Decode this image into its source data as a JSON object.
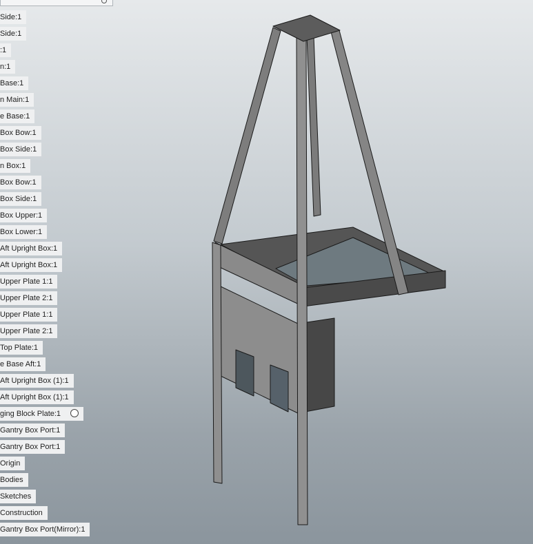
{
  "browser": {
    "items": [
      {
        "label": "Side:1"
      },
      {
        "label": "Side:1"
      },
      {
        "label": ":1"
      },
      {
        "label": "n:1"
      },
      {
        "label": "Base:1"
      },
      {
        "label": "n Main:1"
      },
      {
        "label": "e Base:1"
      },
      {
        "label": "Box Bow:1"
      },
      {
        "label": "Box Side:1"
      },
      {
        "label": "n Box:1"
      },
      {
        "label": "Box Bow:1"
      },
      {
        "label": "Box Side:1"
      },
      {
        "label": "Box Upper:1"
      },
      {
        "label": "Box Lower:1"
      },
      {
        "label": "Aft Upright Box:1"
      },
      {
        "label": "Aft Upright Box:1"
      },
      {
        "label": "Upper Plate 1:1"
      },
      {
        "label": "Upper Plate 2:1"
      },
      {
        "label": "Upper Plate 1:1"
      },
      {
        "label": "Upper Plate 2:1"
      },
      {
        "label": "Top Plate:1"
      },
      {
        "label": "e Base Aft:1"
      },
      {
        "label": "Aft Upright Box (1):1"
      },
      {
        "label": "Aft Upright Box (1):1"
      },
      {
        "label": "ging Block Plate:1",
        "radio": true
      },
      {
        "label": "Gantry Box Port:1"
      },
      {
        "label": "Gantry Box Port:1"
      },
      {
        "label": "Origin"
      },
      {
        "label": "Bodies"
      },
      {
        "label": "Sketches"
      },
      {
        "label": "Construction"
      },
      {
        "label": "Gantry Box Port(Mirror):1"
      }
    ]
  },
  "colors": {
    "panel": "#eff0f1",
    "steel_light": "#8e8e8e",
    "steel_dark": "#3e3e3e",
    "edge": "#1a1a1a"
  }
}
